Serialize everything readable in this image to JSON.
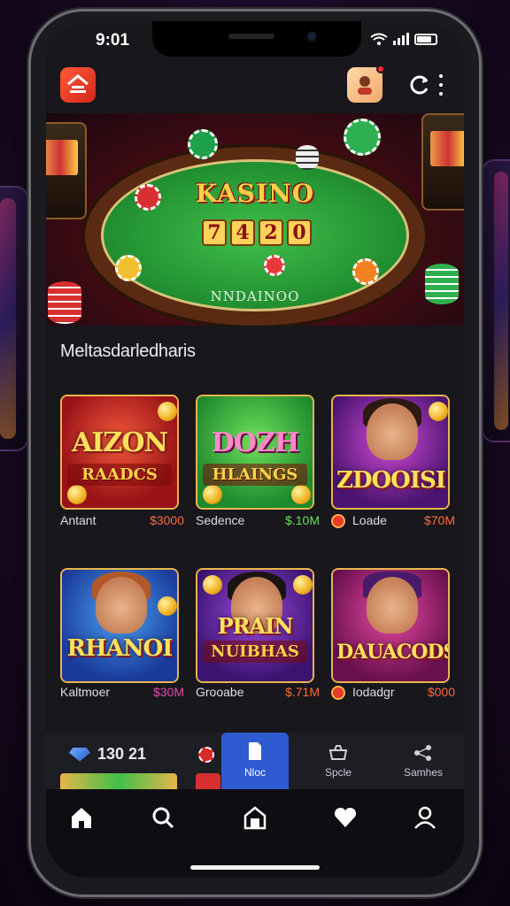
{
  "status_bar": {
    "time": "9:01"
  },
  "hero": {
    "title": "KASINO",
    "number": [
      "7",
      "4",
      "2",
      "0"
    ],
    "subtitle": "NNDAINOO"
  },
  "section": {
    "title": "Meltasdarledharis"
  },
  "games": [
    {
      "title": "AIZON",
      "subtitle": "RAADCS",
      "name": "Antant",
      "price": "$3000",
      "theme": "red"
    },
    {
      "title": "DOZH",
      "subtitle": "HLAINGS",
      "name": "Sedence",
      "price": "$.10M",
      "theme": "green"
    },
    {
      "title": "ZDOOISI",
      "subtitle": "",
      "name": "Loade",
      "price": "$70M",
      "theme": "purple"
    },
    {
      "title": "RHANOI",
      "subtitle": "",
      "name": "Kaltmoer",
      "price": "$30M",
      "theme": "blue"
    },
    {
      "title": "PRAIN",
      "subtitle": "NUIBHAS",
      "name": "Grooabe",
      "price": "$.71M",
      "theme": "violet"
    },
    {
      "title": "DAUACODS",
      "subtitle": "",
      "name": "Iodadgr",
      "price": "$000",
      "theme": "magenta"
    }
  ],
  "balance": {
    "value": "130 21"
  },
  "segments": [
    {
      "label": "Nloc",
      "icon": "document-icon",
      "active": true
    },
    {
      "label": "Spcle",
      "icon": "cart-icon",
      "active": false
    },
    {
      "label": "Samhes",
      "icon": "share-icon",
      "active": false
    }
  ],
  "tab_bar": [
    {
      "icon": "home-icon"
    },
    {
      "icon": "search-icon"
    },
    {
      "icon": "casino-icon"
    },
    {
      "icon": "heart-icon"
    },
    {
      "icon": "profile-icon"
    }
  ],
  "colors": {
    "accent": "#2e5bd1",
    "price": "#ff6a3a",
    "gold": "#e8b64a"
  }
}
